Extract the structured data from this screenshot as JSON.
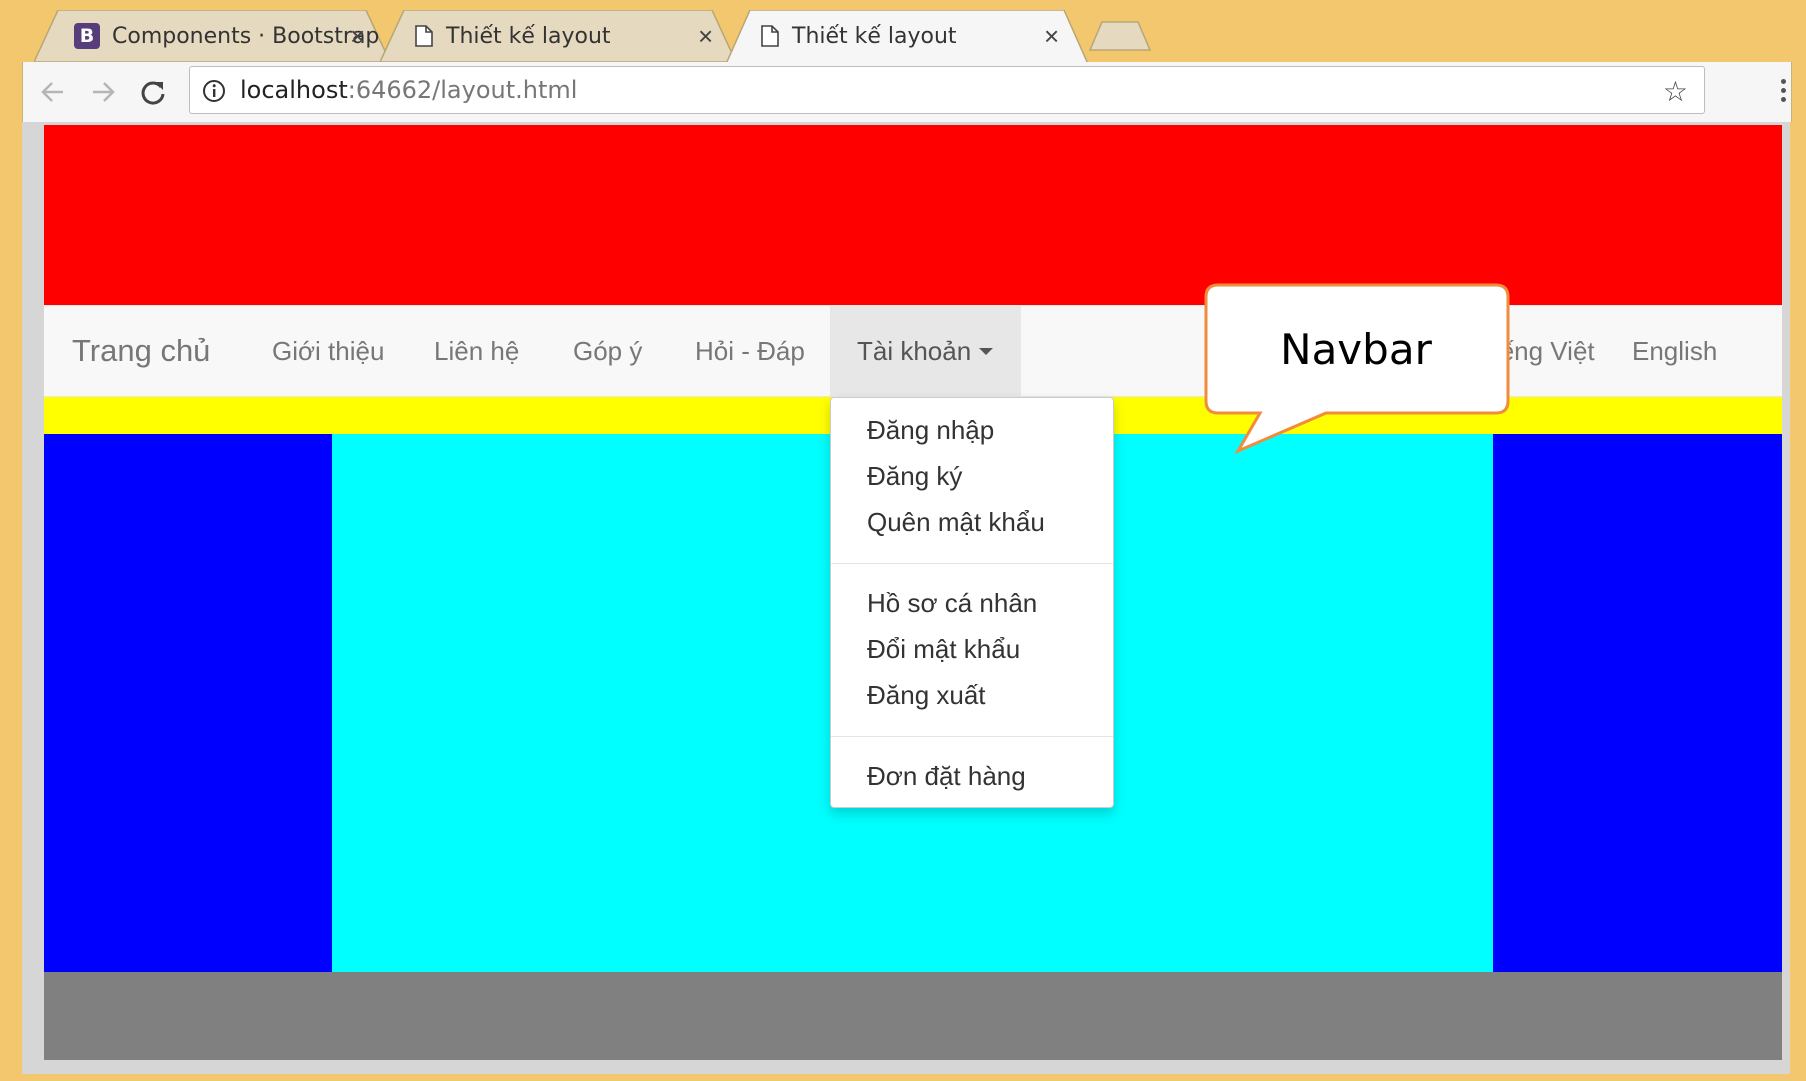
{
  "browser": {
    "tabs": [
      {
        "title": "Components · Bootstrap",
        "favicon": "B",
        "active": false
      },
      {
        "title": "Thiết kế layout",
        "favicon": "page-icon",
        "active": false
      },
      {
        "title": "Thiết kế layout",
        "favicon": "page-icon",
        "active": true
      }
    ],
    "address": {
      "host": "localhost",
      "rest": ":64662/layout.html"
    }
  },
  "navbar": {
    "brand": "Trang chủ",
    "links": [
      "Giới thiệu",
      "Liên hệ",
      "Góp ý",
      "Hỏi - Đáp"
    ],
    "dropdown_label": "Tài khoản",
    "right_links": [
      "Tiếng Việt",
      "English"
    ]
  },
  "dropdown": {
    "groups": [
      [
        "Đăng nhập",
        "Đăng ký",
        "Quên mật khẩu"
      ],
      [
        "Hồ sơ cá nhân",
        "Đổi mật khẩu",
        "Đăng xuất"
      ],
      [
        "Đơn đặt hàng"
      ]
    ]
  },
  "callout": {
    "text": "Navbar"
  },
  "colors": {
    "header": "#ff0000",
    "strip": "#ffff00",
    "sidebars": "#0000ff",
    "content": "#00ffff",
    "footer": "#808080",
    "browser_frame": "#f2c76e",
    "callout_border": "#f08c3c"
  }
}
